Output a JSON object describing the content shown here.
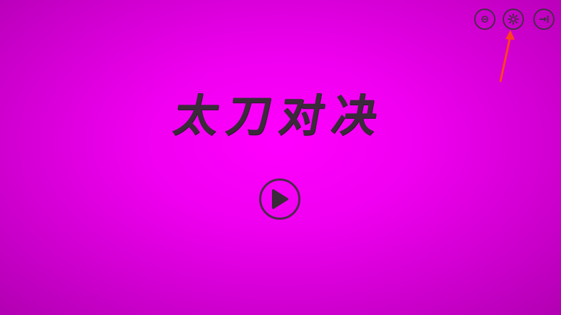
{
  "game": {
    "title": "太刀对决"
  },
  "top_bar": {
    "buttons": [
      {
        "icon": "menu-circle-icon"
      },
      {
        "icon": "gear-icon"
      },
      {
        "icon": "exit-icon"
      }
    ]
  },
  "main": {
    "play_icon": "play-icon"
  },
  "annotation": {
    "arrow_color": "#ff4020",
    "points_to": "settings"
  },
  "colors": {
    "background": "#ff00ff",
    "ink": "#3a2a3a"
  }
}
